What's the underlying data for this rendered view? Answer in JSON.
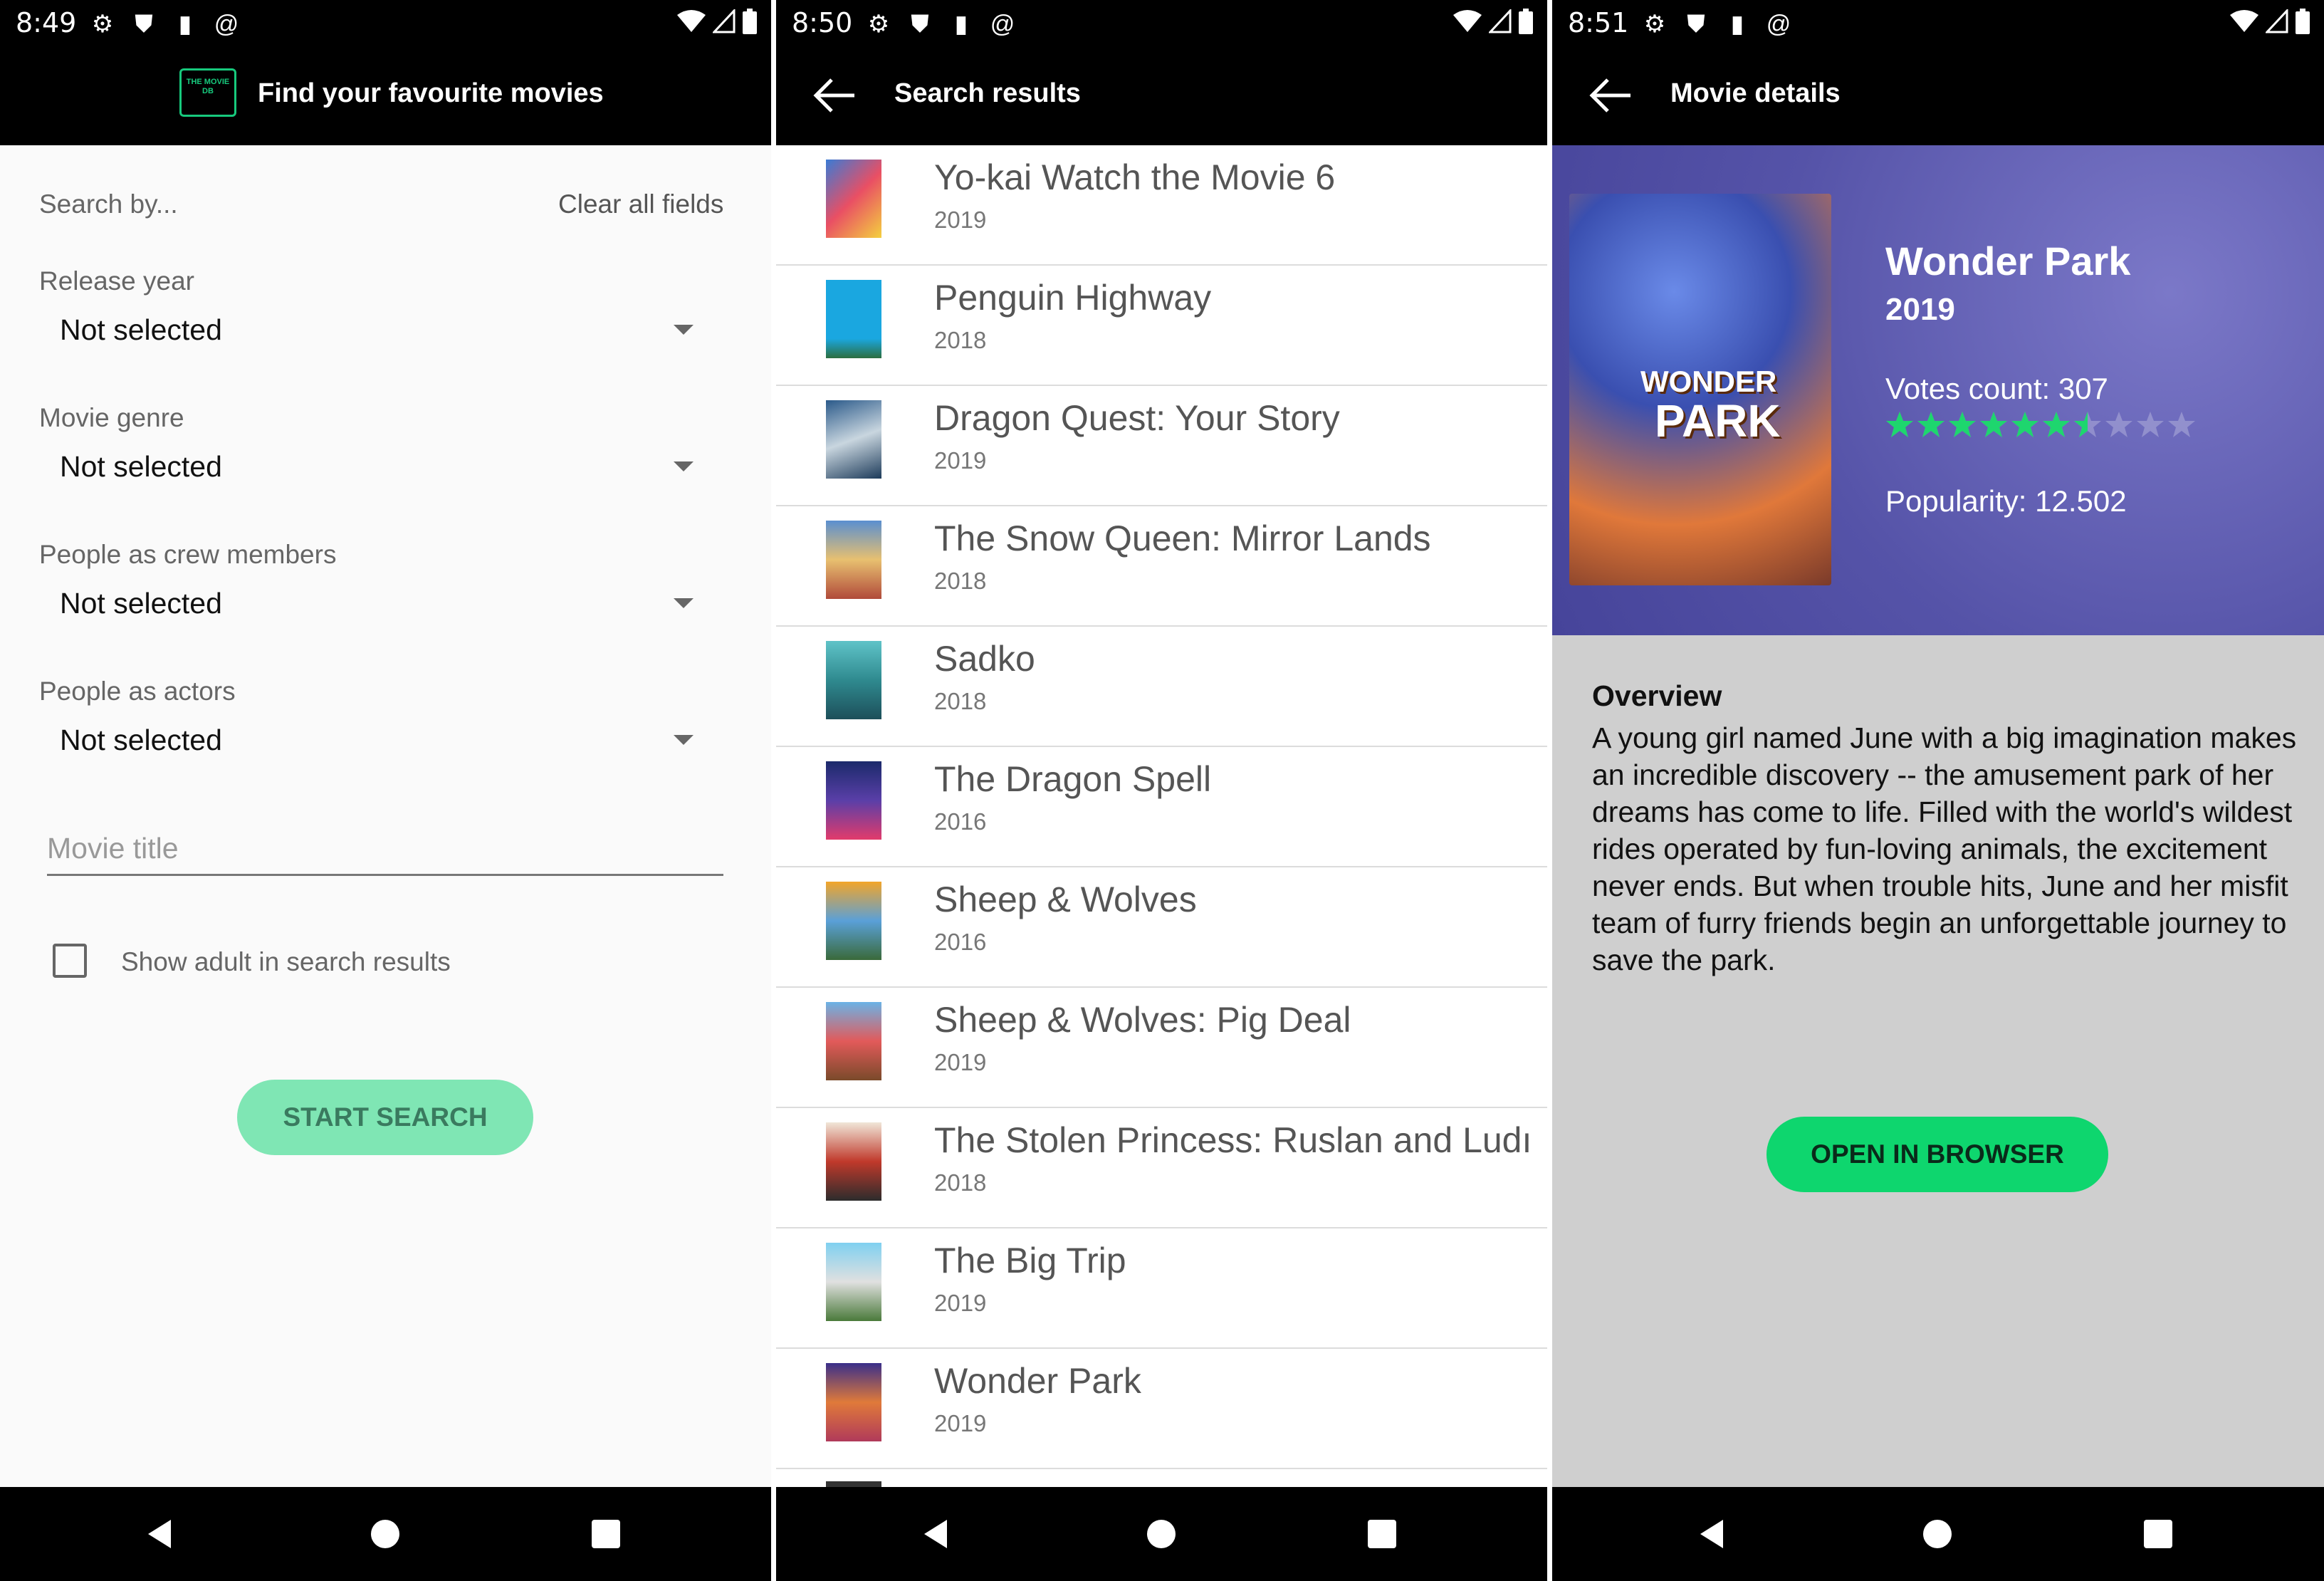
{
  "screen1": {
    "status": {
      "time": "8:49"
    },
    "appbar": {
      "logo_text": "THE MOVIE DB",
      "title": "Find your favourite movies"
    },
    "search_by_label": "Search by...",
    "clear_all_label": "Clear all fields",
    "fields": [
      {
        "label": "Release year",
        "value": "Not selected"
      },
      {
        "label": "Movie genre",
        "value": "Not selected"
      },
      {
        "label": "People as crew members",
        "value": "Not selected"
      },
      {
        "label": "People as actors",
        "value": "Not selected"
      }
    ],
    "movie_title_placeholder": "Movie title",
    "show_adult_label": "Show adult in search results",
    "start_search_label": "START SEARCH"
  },
  "screen2": {
    "status": {
      "time": "8:50"
    },
    "appbar": {
      "title": "Search results"
    },
    "results": [
      {
        "title": "Yo-kai Watch the Movie 6",
        "year": "2019"
      },
      {
        "title": "Penguin Highway",
        "year": "2018"
      },
      {
        "title": "Dragon Quest: Your Story",
        "year": "2019"
      },
      {
        "title": "The Snow Queen: Mirror Lands",
        "year": "2018"
      },
      {
        "title": "Sadko",
        "year": "2018"
      },
      {
        "title": "The Dragon Spell",
        "year": "2016"
      },
      {
        "title": "Sheep & Wolves",
        "year": "2016"
      },
      {
        "title": "Sheep & Wolves: Pig Deal",
        "year": "2019"
      },
      {
        "title": "The Stolen Princess: Ruslan and Ludı",
        "year": "2018"
      },
      {
        "title": "The Big Trip",
        "year": "2019"
      },
      {
        "title": "Wonder Park",
        "year": "2019"
      }
    ]
  },
  "screen3": {
    "status": {
      "time": "8:51"
    },
    "appbar": {
      "title": "Movie details"
    },
    "poster_text": {
      "line1": "WONDER",
      "line2": "PARK"
    },
    "movie": {
      "title": "Wonder Park",
      "year": "2019",
      "votes": "Votes count: 307",
      "popularity": "Popularity: 12.502",
      "rating_stars": 6.5,
      "rating_max": 10
    },
    "overview_heading": "Overview",
    "overview_text": "A young girl named June with a big imagination makes an incredible discovery -- the amusement park of her dreams has come to life. Filled with the world's wildest rides operated by fun-loving animals, the excitement never ends. But when trouble hits, June and her misfit team of furry friends begin an unforgettable journey to save the park.",
    "open_browser_label": "OPEN IN BROWSER"
  },
  "colors": {
    "accent_green": "#0ed66e",
    "start_button": "#7fe6b4",
    "banner": "#5553a8",
    "star_green": "#1ed66e"
  }
}
